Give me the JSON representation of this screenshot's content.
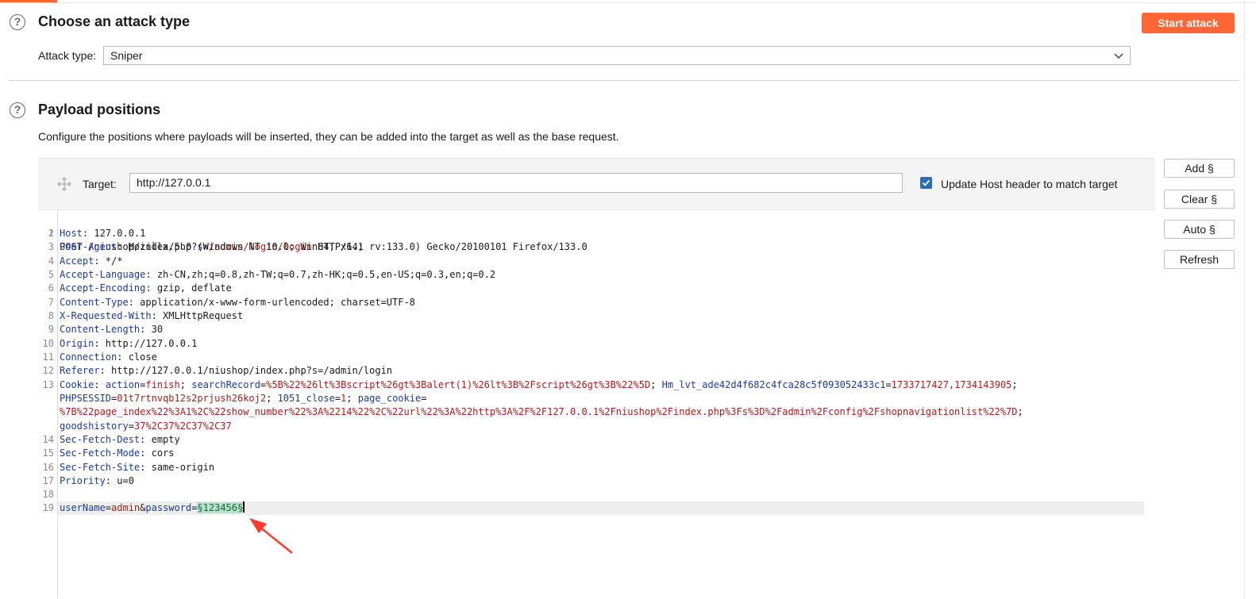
{
  "attack_section": {
    "title": "Choose an attack type",
    "start_button": "Start attack",
    "attack_type_label": "Attack type:",
    "attack_type_value": "Sniper"
  },
  "positions_section": {
    "title": "Payload positions",
    "description": "Configure the positions where payloads will be inserted, they can be added into the target as well as the base request.",
    "target_label": "Target:",
    "target_value": "http://127.0.0.1",
    "update_host_label": "Update Host header to match target",
    "update_host_checked": true,
    "buttons": {
      "add": "Add §",
      "clear": "Clear §",
      "auto": "Auto §",
      "refresh": "Refresh"
    }
  },
  "request": {
    "l1_ln": "1",
    "l1_a": "POST /niushop/index.php?",
    "l1_b": "s",
    "l1_c": "=",
    "l1_d": "/admin/login/login",
    "l1_e": " HTTP/1.1",
    "l2_ln": "2",
    "l2_k": "Host",
    "l2_v": ": 127.0.0.1",
    "l3_ln": "3",
    "l3_k": "User-Agent",
    "l3_v": ": Mozilla/5.0 (Windows NT 10.0; Win64; x64; rv:133.0) Gecko/20100101 Firefox/133.0",
    "l4_ln": "4",
    "l4_k": "Accept",
    "l4_v": ": */*",
    "l5_ln": "5",
    "l5_k": "Accept-Language",
    "l5_v": ": zh-CN,zh;q=0.8,zh-TW;q=0.7,zh-HK;q=0.5,en-US;q=0.3,en;q=0.2",
    "l6_ln": "6",
    "l6_k": "Accept-Encoding",
    "l6_v": ": gzip, deflate",
    "l7_ln": "7",
    "l7_k": "Content-Type",
    "l7_v": ": application/x-www-form-urlencoded; charset=UTF-8",
    "l8_ln": "8",
    "l8_k": "X-Requested-With",
    "l8_v": ": XMLHttpRequest",
    "l9_ln": "9",
    "l9_k": "Content-Length",
    "l9_v": ": 30",
    "l10_ln": "10",
    "l10_k": "Origin",
    "l10_v": ": http://127.0.0.1",
    "l11_ln": "11",
    "l11_k": "Connection",
    "l11_v": ": close",
    "l12_ln": "12",
    "l12_k": "Referer",
    "l12_v": ": http://127.0.0.1/niushop/index.php?s=/admin/login",
    "l13_ln": "13",
    "l13_k": "Cookie",
    "l13_p1": ": ",
    "l13_ck1": "action",
    "l13_eq1": "=",
    "l13_cv1": "finish",
    "l13_sc1": "; ",
    "l13_ck2": "searchRecord",
    "l13_eq2": "=",
    "l13_cv2": "%5B%22%26lt%3Bscript%26gt%3Balert(1)%26lt%3B%2Fscript%26gt%3B%22%5D",
    "l13_sc2": "; ",
    "l13_ck3": "Hm_lvt_ade42d4f682c4fca28c5f093052433c1",
    "l13_eq3": "=",
    "l13_cv3": "1733717427,1734143905",
    "l13_sc3": ";",
    "l13b_ck4": "PHPSESSID",
    "l13b_eq4": "=",
    "l13b_cv4": "01t7rtnvqb12s2prjush26koj2",
    "l13b_sc4": "; ",
    "l13b_ck5": "1051_close",
    "l13b_eq5": "=",
    "l13b_cv5": "1",
    "l13b_sc5": "; ",
    "l13b_ck6": "page_cookie",
    "l13b_eq6": "=",
    "l13c_cv6": "%7B%22page_index%22%3A1%2C%22show_number%22%3A%2214%22%2C%22url%22%3A%22http%3A%2F%2F127.0.0.1%2Fniushop%2Findex.php%3Fs%3D%2Fadmin%2Fconfig%2Fshopnavigationlist%22%7D",
    "l13c_sc6": ";",
    "l13d_ck7": "goodshistory",
    "l13d_eq7": "=",
    "l13d_cv7": "37%2C37%2C37%2C37",
    "l14_ln": "14",
    "l14_k": "Sec-Fetch-Dest",
    "l14_v": ": empty",
    "l15_ln": "15",
    "l15_k": "Sec-Fetch-Mode",
    "l15_v": ": cors",
    "l16_ln": "16",
    "l16_k": "Sec-Fetch-Site",
    "l16_v": ": same-origin",
    "l17_ln": "17",
    "l17_k": "Priority",
    "l17_v": ": u=0",
    "l18_ln": "18",
    "l19_ln": "19",
    "l19_k1": "userName",
    "l19_eq1": "=",
    "l19_v1": "admin",
    "l19_amp": "&",
    "l19_k2": "password",
    "l19_eq2": "=",
    "l19_payload": "§123456§"
  },
  "colors": {
    "accent": "#ff6633",
    "key": "#1a3aa6",
    "value_red": "#b51a1a",
    "payload_bg": "#b9e0cc",
    "arrow": "#ff3b30"
  }
}
